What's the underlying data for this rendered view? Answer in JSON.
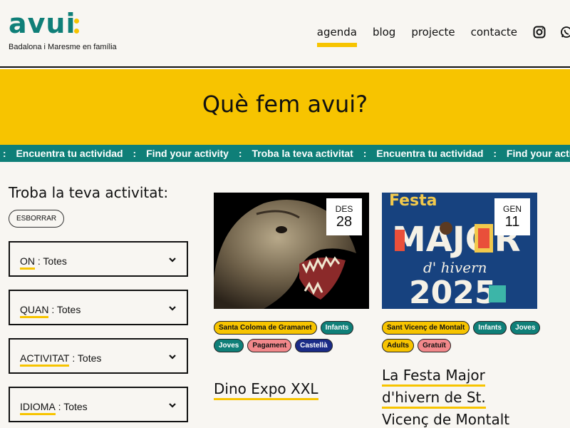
{
  "brand": {
    "name": "avui",
    "tagline": "Badalona i Maresme en família"
  },
  "nav": {
    "items": [
      "agenda",
      "blog",
      "projecte",
      "contacte"
    ],
    "active": "agenda",
    "icons": [
      "instagram-icon",
      "whatsapp-icon"
    ]
  },
  "hero": {
    "title": "Què fem avui?"
  },
  "ticker": {
    "items": [
      "Encuentra tu actividad",
      "Find your activity",
      "Troba la teva activitat",
      "Encuentra tu actividad",
      "Find your activity"
    ]
  },
  "sidebar": {
    "title": "Troba la teva activitat:",
    "clear_label": "ESBORRAR",
    "filters": [
      {
        "key": "ON",
        "value": "Totes"
      },
      {
        "key": "QUAN",
        "value": "Totes"
      },
      {
        "key": "ACTIVITAT",
        "value": "Totes"
      },
      {
        "key": "IDIOMA",
        "value": "Totes"
      }
    ]
  },
  "events": [
    {
      "month": "DES",
      "day": "28",
      "tags": [
        {
          "label": "Santa Coloma de Gramanet",
          "color": "yellow"
        },
        {
          "label": "Infants",
          "color": "teal"
        },
        {
          "label": "Joves",
          "color": "teal"
        },
        {
          "label": "Pagament",
          "color": "pink"
        },
        {
          "label": "Castellà",
          "color": "navy"
        }
      ],
      "title_lines": [
        "Dino Expo XXL"
      ]
    },
    {
      "month": "GEN",
      "day": "11",
      "tags": [
        {
          "label": "Sant Vicenç de Montalt",
          "color": "yellow"
        },
        {
          "label": "Infants",
          "color": "teal"
        },
        {
          "label": "Joves",
          "color": "teal"
        },
        {
          "label": "Adults",
          "color": "yellow"
        },
        {
          "label": "Gratuït",
          "color": "pink"
        }
      ],
      "title_lines": [
        "La Festa Major",
        "d'hivern de St.",
        "Vicenç de Montalt"
      ],
      "poster": {
        "line1": "Festa",
        "line2": "MAJOR",
        "line3": "d' hivern",
        "line4": "2025"
      }
    }
  ],
  "colors": {
    "teal": "#0f7f78",
    "yellow": "#f7c400",
    "pink": "#f2888b",
    "navy": "#1a2b87"
  }
}
